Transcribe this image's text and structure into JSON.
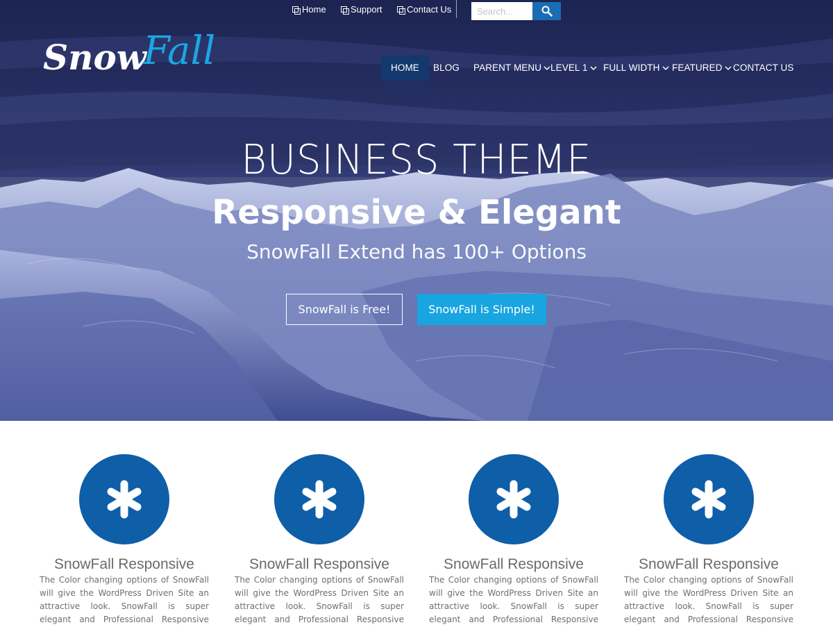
{
  "topbar": {
    "links": [
      {
        "label": "Home",
        "icon": "page-icon"
      },
      {
        "label": "Support",
        "icon": "page-icon"
      },
      {
        "label": "Contact Us",
        "icon": "page-icon"
      }
    ],
    "search": {
      "placeholder": "Search...",
      "button_icon": "search-icon"
    }
  },
  "logo": {
    "part1": "Snow",
    "part2": "Fall",
    "color1": "#ffffff",
    "color2": "#1aa6e4"
  },
  "nav": {
    "items": [
      {
        "label": "HOME",
        "active": true,
        "has_dropdown": false
      },
      {
        "label": "BLOG",
        "active": false,
        "has_dropdown": false
      },
      {
        "label": "PARENT MENU",
        "active": false,
        "has_dropdown": true
      },
      {
        "label": "LEVEL 1",
        "active": false,
        "has_dropdown": true
      },
      {
        "label": "FULL WIDTH",
        "active": false,
        "has_dropdown": true
      },
      {
        "label": "FEATURED",
        "active": false,
        "has_dropdown": true
      },
      {
        "label": "CONTACT US",
        "active": false,
        "has_dropdown": false
      }
    ]
  },
  "hero": {
    "title": "BUSINESS THEME",
    "subtitle": "Responsive & Elegant",
    "tagline": "SnowFall Extend has 100+ Options",
    "button_primary": "SnowFall is Free!",
    "button_secondary": "SnowFall is Simple!"
  },
  "features": [
    {
      "icon": "asterisk-icon",
      "title": "SnowFall Responsive",
      "text": "The Color changing options of SnowFall will give the WordPress Driven Site an attractive look. SnowFall is super elegant and Professional Responsive Theme which"
    },
    {
      "icon": "asterisk-icon",
      "title": "SnowFall Responsive",
      "text": "The Color changing options of SnowFall will give the WordPress Driven Site an attractive look. SnowFall is super elegant and Professional Responsive Theme which"
    },
    {
      "icon": "asterisk-icon",
      "title": "SnowFall Responsive",
      "text": "The Color changing options of SnowFall will give the WordPress Driven Site an attractive look. SnowFall is super elegant and Professional Responsive Theme which"
    },
    {
      "icon": "asterisk-icon",
      "title": "SnowFall Responsive",
      "text": "The Color changing options of SnowFall will give the WordPress Driven Site an attractive look. SnowFall is super elegant and Professional Responsive Theme which"
    }
  ],
  "colors": {
    "accent": "#18a5e0",
    "nav_active": "#14386e",
    "feature_circle": "#0e5ea8",
    "search_button": "#1a6db5"
  }
}
